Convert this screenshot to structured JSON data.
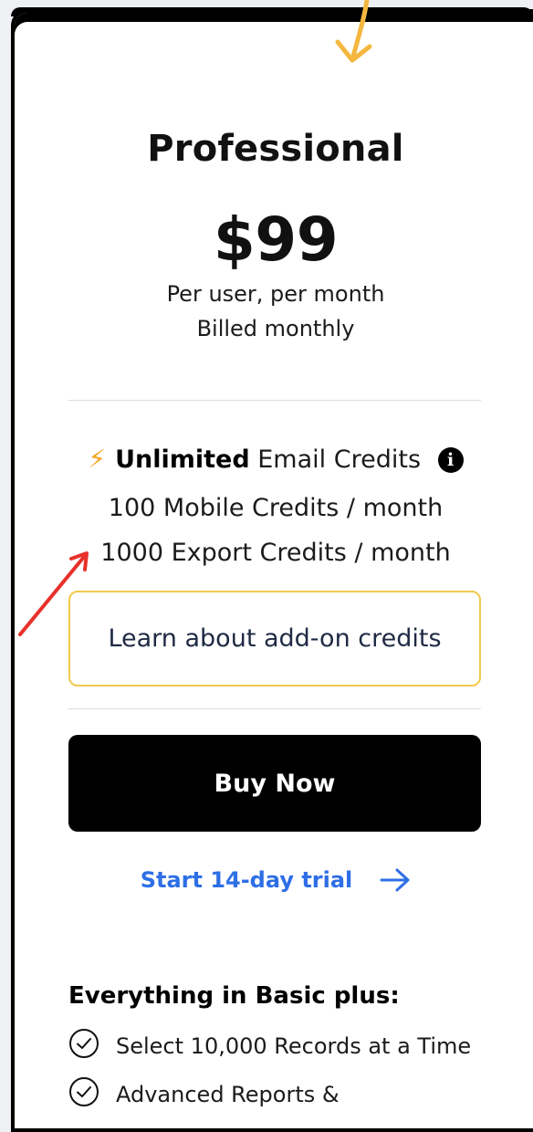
{
  "plan": {
    "name": "Professional",
    "price": "$99",
    "billing_unit": "Per user, per month",
    "billing_cycle": "Billed monthly"
  },
  "credits": {
    "email_bold": "Unlimited",
    "email_rest": "Email Credits",
    "info_glyph": "i",
    "mobile": "100 Mobile Credits / month",
    "export": "1000 Export Credits / month"
  },
  "actions": {
    "addon_label": "Learn about add-on credits",
    "buy_label": "Buy Now",
    "trial_label": "Start 14-day trial"
  },
  "features": {
    "title": "Everything in Basic plus:",
    "items": [
      "Select 10,000 Records at a Time",
      "Advanced Reports &"
    ]
  },
  "icons": {
    "bolt": "lightning-bolt-icon",
    "info": "info-icon",
    "arrow": "arrow-right-icon",
    "check": "check-circle-icon"
  },
  "colors": {
    "accent_blue": "#2e6fe6",
    "bolt_orange": "#f6a623",
    "addon_border": "#f2c94c",
    "annotation_red": "#e8302a",
    "annotation_yellow": "#f4b73f"
  }
}
